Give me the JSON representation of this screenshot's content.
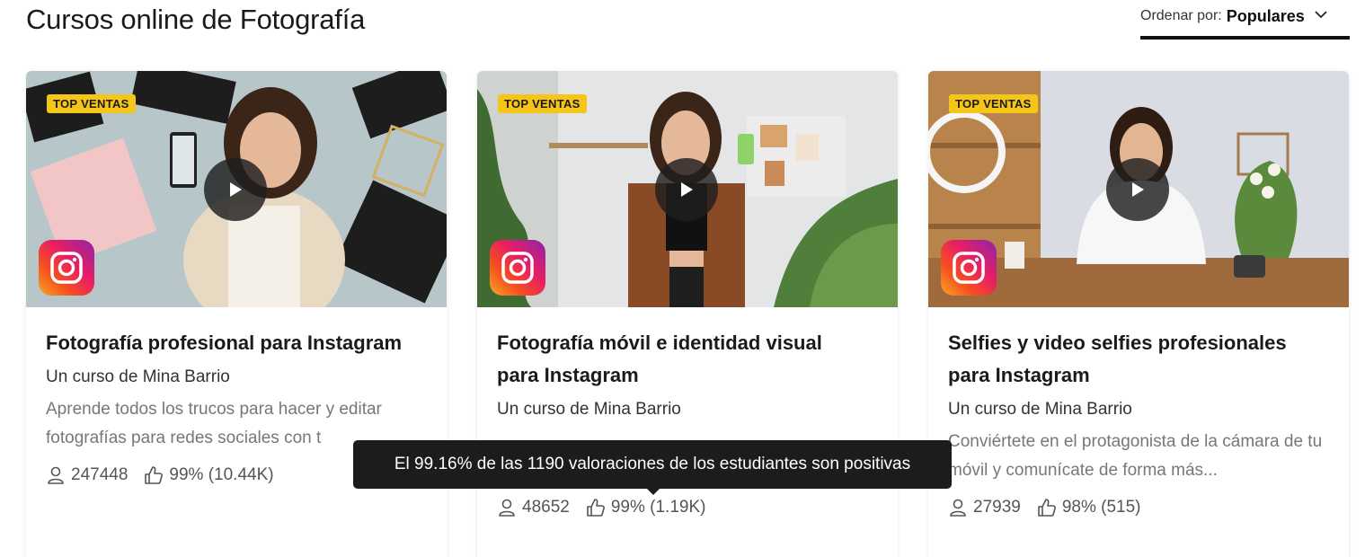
{
  "page": {
    "title": "Cursos online de Fotografía"
  },
  "sort": {
    "label": "Ordenar por:",
    "value": "Populares"
  },
  "courses": [
    {
      "badge": "TOP VENTAS",
      "title_lines": [
        "Fotografía profesional para Instagram"
      ],
      "author": "Un curso de Mina Barrio",
      "description": "Aprende todos los trucos para hacer y editar fotografías para redes sociales con t",
      "students": "247448",
      "rating": "99% (10.44K)"
    },
    {
      "badge": "TOP VENTAS",
      "title_lines": [
        "Fotografía móvil e identidad visual",
        "para Instagram"
      ],
      "author": "Un curso de Mina Barrio",
      "description": "",
      "students": "48652",
      "rating": "99% (1.19K)"
    },
    {
      "badge": "TOP VENTAS",
      "title_lines": [
        "Selfies y video selfies profesionales",
        "para Instagram"
      ],
      "author": "Un curso de Mina Barrio",
      "description": "Conviértete en el protagonista de la cámara de tu móvil y comunícate de forma más...",
      "students": "27939",
      "rating": "98% (515)"
    }
  ],
  "tooltip": {
    "text": "El 99.16% de las 1190 valoraciones de los estudiantes son positivas"
  },
  "icons": {
    "play": "play-icon",
    "instagram": "instagram-icon",
    "students": "user-icon",
    "rating": "thumbs-up-icon",
    "sort": "chevron-down-icon"
  },
  "colors": {
    "badge": "#f5c518",
    "tooltip": "#1c1c1c",
    "sort_underline": "#111111"
  }
}
